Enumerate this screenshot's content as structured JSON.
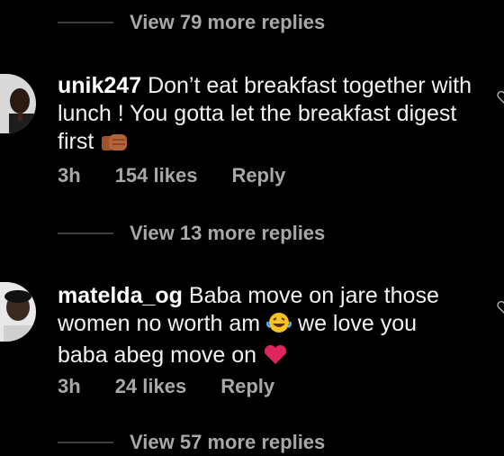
{
  "threads": [
    {
      "view_replies": "View 79 more replies"
    },
    {
      "username": "unik247",
      "text": "Don’t eat breakfast together with lunch ! You gotta let the breakfast digest first",
      "emoji": "fist-bump",
      "time": "3h",
      "likes": "154 likes",
      "reply": "Reply",
      "view_replies": "View 13 more replies"
    },
    {
      "username": "matelda_og",
      "text_a": "Baba move on jare those women no worth am",
      "emoji_a": "laughing-tears",
      "text_b": "we love you baba  abeg move on",
      "emoji_b": "red-heart",
      "time": "3h",
      "likes": "24 likes",
      "reply": "Reply",
      "view_replies": "View 57 more replies"
    }
  ],
  "colors": {
    "background": "#000000",
    "muted": "#a8a8a8",
    "text": "#f2f2f2",
    "heart": "#e0245e"
  }
}
